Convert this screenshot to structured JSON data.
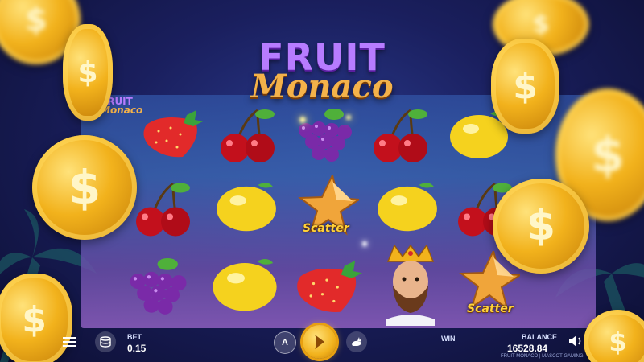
{
  "logo": {
    "line1": "FRUIT",
    "line2": "Monaco"
  },
  "mini_logo": {
    "line1": "FRUIT",
    "line2": "Monaco"
  },
  "grid": [
    [
      "strawberry",
      "cherry",
      "grapes",
      "cherry",
      "lemon"
    ],
    [
      "cherry",
      "lemon",
      "scatter",
      "lemon",
      "cherry"
    ],
    [
      "grapes",
      "lemon",
      "strawberry",
      "king",
      "scatter"
    ]
  ],
  "scatter_label": "Scatter",
  "controls": {
    "bet_label": "BET",
    "bet_value": "0.15",
    "win_label": "WIN",
    "win_value": "",
    "balance_label": "BALANCE",
    "balance_value": "16528.84",
    "autoplay_letter": "A",
    "footer": "FRUIT MONACO | MASCOT GAMING"
  },
  "icons": [
    "menu-icon",
    "coins-stack-icon",
    "autoplay-icon",
    "spin-icon",
    "turbo-rabbit-icon",
    "sound-icon"
  ],
  "colors": {
    "accent": "#f2b21c",
    "logo_purple": "#b77cff",
    "logo_gold": "#f4b24a"
  }
}
